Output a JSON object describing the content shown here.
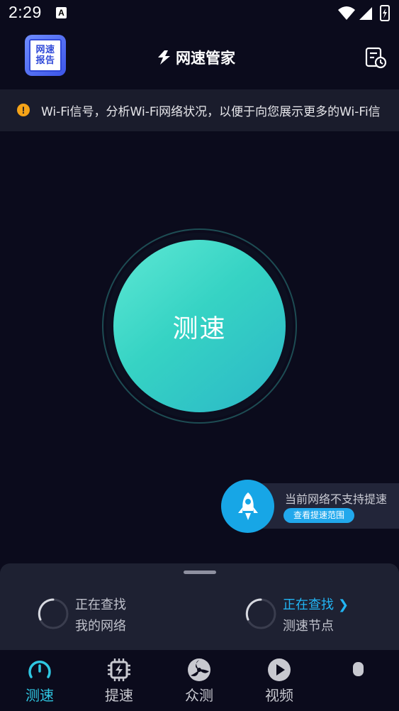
{
  "status_bar": {
    "time": "2:29",
    "notification_icon": "A",
    "icons": [
      "wifi-icon",
      "signal-icon",
      "battery-icon"
    ]
  },
  "header": {
    "report_button": {
      "line1": "网速",
      "line2": "报告"
    },
    "brand_name": "网速管家",
    "history_icon": "history-icon"
  },
  "notice": {
    "icon": "!",
    "text": "Wi-Fi信号，分析Wi-Fi网络状况，以便于向您展示更多的Wi-Fi信"
  },
  "speed_test": {
    "button_label": "测速"
  },
  "boost_card": {
    "message": "当前网络不支持提速",
    "link_label": "查看提速范围"
  },
  "bottom_sheet": {
    "my_network": {
      "line1": "正在查找",
      "line2": "我的网络"
    },
    "test_node": {
      "line1": "正在查找",
      "line2": "测速节点"
    }
  },
  "tabs": [
    {
      "label": "测速",
      "icon": "speedometer-icon",
      "active": true
    },
    {
      "label": "提速",
      "icon": "chip-boost-icon",
      "active": false
    },
    {
      "label": "众测",
      "icon": "community-test-icon",
      "active": false
    },
    {
      "label": "视频",
      "icon": "play-icon",
      "active": false
    }
  ],
  "colors": {
    "background": "#0b0b1c",
    "accent_teal": "#36d3c4",
    "accent_blue": "#17a6e6",
    "active_tab": "#2fc7e2",
    "notice_warning": "#f5a318"
  }
}
